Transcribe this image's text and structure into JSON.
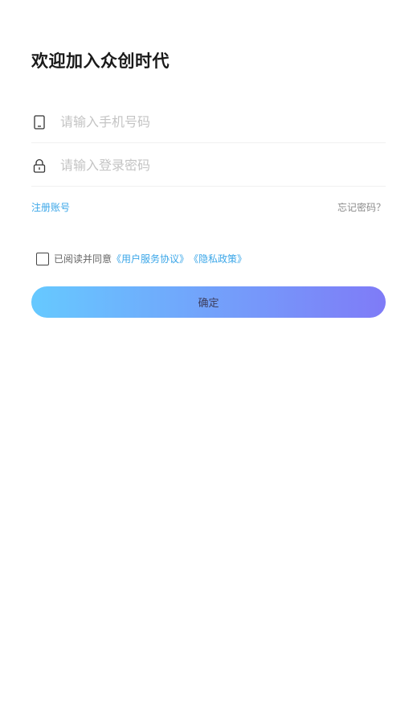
{
  "title": "欢迎加入众创时代",
  "phone_field": {
    "icon": "phone-icon",
    "placeholder": "请输入手机号码",
    "value": ""
  },
  "password_field": {
    "icon": "lock-icon",
    "placeholder": "请输入登录密码",
    "value": ""
  },
  "links": {
    "register": "注册账号",
    "forgot": "忘记密码？"
  },
  "agreement": {
    "checked": false,
    "prefix": "已阅读并同意",
    "user_agreement": "《用户服务协议》",
    "privacy_policy": "《隐私政策》"
  },
  "confirm_button": "确定",
  "colors": {
    "accent": "#3aa6e8",
    "gradient_start": "#66c9ff",
    "gradient_end": "#7f7bf7"
  }
}
